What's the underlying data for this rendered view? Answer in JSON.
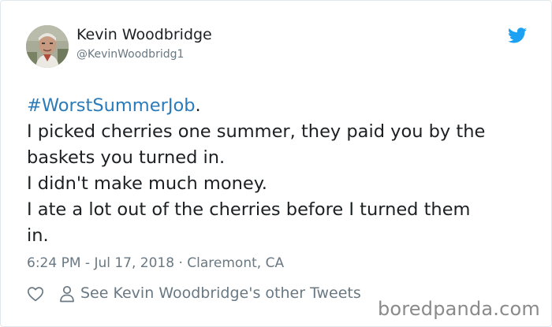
{
  "tweet": {
    "author_name": "Kevin Woodbridge",
    "author_handle": "@KevinWoodbridg1",
    "hashtag": "#WorstSummerJob",
    "hashtag_suffix": ".",
    "lines": [
      "I picked cherries one summer, they paid you by the",
      "baskets you turned in.",
      "I didn't make much money.",
      "I ate a lot out of the cherries before I turned them",
      "in."
    ],
    "timestamp": "6:24 PM - Jul 17, 2018",
    "separator": "·",
    "location": "Claremont, CA",
    "other_tweets_label": "See Kevin Woodbridge's other Tweets"
  },
  "icons": {
    "brand": "twitter-bird-icon",
    "like": "heart-icon",
    "profile": "person-icon"
  },
  "colors": {
    "hashtag": "#2b7bb9",
    "twitter_blue": "#1da1f2",
    "secondary_text": "#697882",
    "primary_text": "#1c2022"
  },
  "watermark": {
    "text": "boredpanda.com"
  }
}
